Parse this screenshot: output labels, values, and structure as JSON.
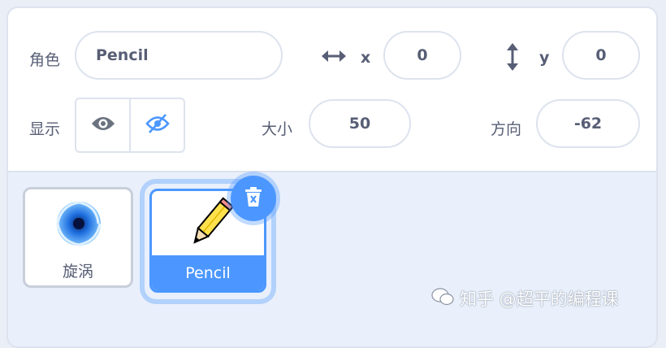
{
  "sprite_info": {
    "sprite_label": "角色",
    "sprite_name": "Pencil",
    "x_label": "x",
    "x_value": "0",
    "y_label": "y",
    "y_value": "0",
    "show_label": "显示",
    "size_label": "大小",
    "size_value": "50",
    "direction_label": "方向",
    "direction_value": "-62"
  },
  "sprites": [
    {
      "name": "旋涡",
      "icon": "vortex-icon",
      "selected": false
    },
    {
      "name": "Pencil",
      "icon": "pencil-icon",
      "selected": true
    }
  ],
  "watermark": {
    "text": "知乎 @超平的编程课"
  },
  "colors": {
    "accent": "#4c97ff",
    "text": "#575e75",
    "border": "#dde3ee",
    "panel_bg": "#e9f0fb"
  }
}
